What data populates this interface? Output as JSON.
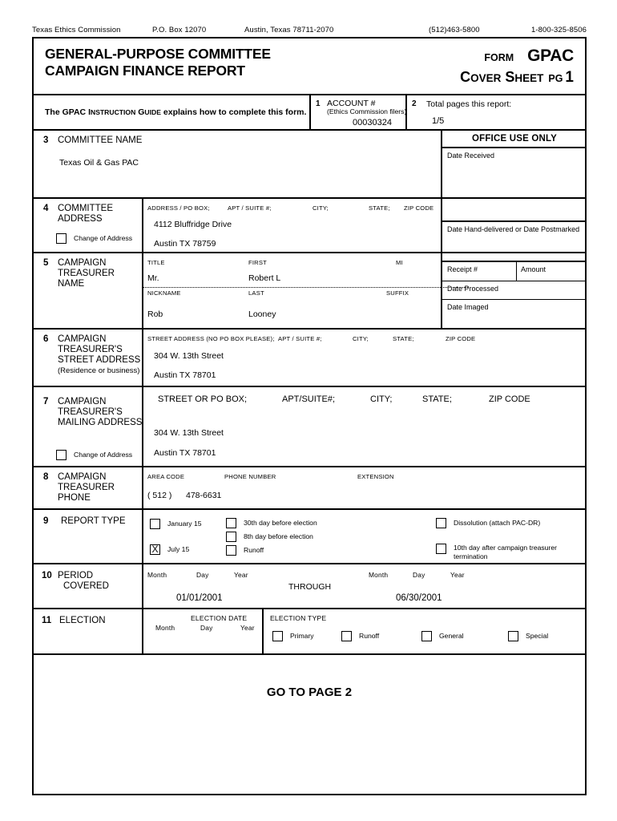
{
  "agency": {
    "name": "Texas Ethics Commission",
    "po_box": "P.O. Box 12070",
    "city_state_zip": "Austin, Texas 78711-2070",
    "phone": "(512)463-5800",
    "toll_free": "1-800-325-8506"
  },
  "header": {
    "title_line1": "GENERAL-PURPOSE COMMITTEE",
    "title_line2": "CAMPAIGN FINANCE REPORT",
    "form_label": "FORM",
    "form_code": "GPAC",
    "cover_c": "C",
    "cover_over": "OVER",
    "sheet_s": "S",
    "sheet_heet": "HEET",
    "pg_label": "PG",
    "pg_number": "1"
  },
  "instruction": {
    "text_pre": "The GPAC ",
    "text_i_cap": "I",
    "text_i_rest": "NSTRUCTION",
    "text_g_cap": " G",
    "text_g_rest": "UIDE",
    "text_post": " explains how to complete this form."
  },
  "box1": {
    "number": "1",
    "label": "ACCOUNT #",
    "sublabel": "(Ethics Commission filers)",
    "value": "00030324"
  },
  "box2": {
    "number": "2",
    "label": "Total pages this report:",
    "value": "1/5"
  },
  "office_use": {
    "title": "OFFICE USE ONLY",
    "date_received": "Date Received",
    "date_hand_delivered": "Date Hand-delivered or Date Postmarked",
    "receipt": "Receipt #",
    "amount": "Amount",
    "date_processed": "Date Processed",
    "date_imaged": "Date Imaged"
  },
  "box3": {
    "number": "3",
    "label": "COMMITTEE NAME",
    "value": "Texas Oil & Gas PAC"
  },
  "box4": {
    "number": "4",
    "label_line1": "COMMITTEE",
    "label_line2": "ADDRESS",
    "change_of_address": "Change of Address",
    "hdr_address": "ADDRESS / PO BOX;",
    "hdr_apt": "APT / SUITE #;",
    "hdr_city": "CITY;",
    "hdr_state": "STATE;",
    "hdr_zip": "ZIP CODE",
    "street": "4112 Bluffridge Drive",
    "citystatezip": "Austin   TX   78759"
  },
  "box5": {
    "number": "5",
    "label_line1": "CAMPAIGN",
    "label_line2": "TREASURER",
    "label_line3": "NAME",
    "hdr_title": "TITLE",
    "hdr_first": "FIRST",
    "hdr_mi": "MI",
    "hdr_nickname": "NICKNAME",
    "hdr_last": "LAST",
    "hdr_suffix": "SUFFIX",
    "title": "Mr.",
    "first": "Robert L",
    "mi": "",
    "nickname": "Rob",
    "last": "Looney",
    "suffix": ""
  },
  "box6": {
    "number": "6",
    "label_line1": "CAMPAIGN",
    "label_line2": "TREASURER'S",
    "label_line3": "STREET ADDRESS",
    "label_line4": "(Residence  or  business)",
    "hdr_street": "STREET ADDRESS (NO PO BOX PLEASE);",
    "hdr_apt": "APT / SUITE #;",
    "hdr_city": "CITY;",
    "hdr_state": "STATE;",
    "hdr_zip": "ZIP CODE",
    "street": "304 W. 13th Street",
    "citystatezip": "Austin   TX   78701"
  },
  "box7": {
    "number": "7",
    "label_line1": "CAMPAIGN",
    "label_line2": "TREASURER'S",
    "label_line3": "MAILING ADDRESS",
    "change_of_address": "Change of Address",
    "hdr_street": "STREET OR PO BOX;",
    "hdr_apt": "APT/SUITE#;",
    "hdr_city": "CITY;",
    "hdr_state": "STATE;",
    "hdr_zip": "ZIP CODE",
    "street": "304 W. 13th Street",
    "citystatezip": "Austin   TX   78701"
  },
  "box8": {
    "number": "8",
    "label_line1": "CAMPAIGN",
    "label_line2": "TREASURER",
    "label_line3": "PHONE",
    "hdr_area": "AREA CODE",
    "hdr_phone": "PHONE NUMBER",
    "hdr_ext": "EXTENSION",
    "area_code": "( 512 )",
    "number_value": "478-6631"
  },
  "box9": {
    "number": "9",
    "label": "REPORT TYPE",
    "options": [
      {
        "label": "January 15",
        "checked": false
      },
      {
        "label": "July 15",
        "checked": true
      },
      {
        "label": "30th day before election",
        "checked": false
      },
      {
        "label": "8th day before election",
        "checked": false
      },
      {
        "label": "Runoff",
        "checked": false
      },
      {
        "label": "Dissolution (attach PAC-DR)",
        "checked": false
      },
      {
        "label": "10th day after campaign treasurer termination",
        "checked": false
      }
    ]
  },
  "box10": {
    "number": "10",
    "label_line1": "PERIOD",
    "label_line2": "COVERED",
    "hdr_month": "Month",
    "hdr_day": "Day",
    "hdr_year": "Year",
    "through": "THROUGH",
    "from_date": "01/01/2001",
    "to_date": "06/30/2001"
  },
  "box11": {
    "number": "11",
    "label": "ELECTION",
    "election_date_label": "ELECTION DATE",
    "hdr_month": "Month",
    "hdr_day": "Day",
    "hdr_year": "Year",
    "election_type_label": "ELECTION TYPE",
    "date_value": "",
    "types": [
      {
        "label": "Primary",
        "checked": false
      },
      {
        "label": "Runoff",
        "checked": false
      },
      {
        "label": "General",
        "checked": false
      },
      {
        "label": "Special",
        "checked": false
      }
    ]
  },
  "footer": {
    "go_to_page": "GO TO PAGE 2"
  }
}
